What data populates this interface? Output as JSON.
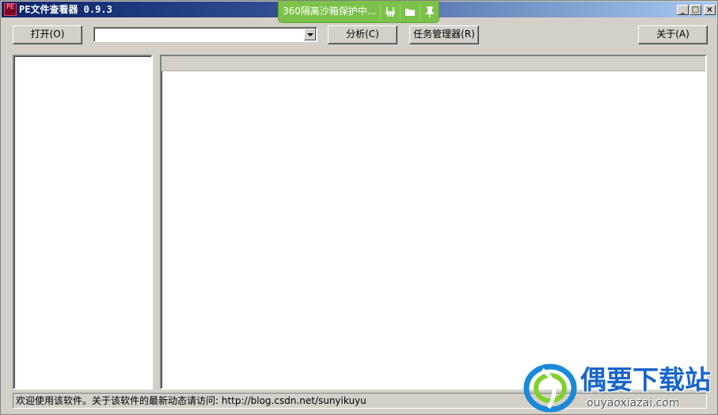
{
  "window": {
    "title": "PE文件查看器 0.9.3",
    "app_icon_text": "PE"
  },
  "caption_buttons": {
    "minimize": "_",
    "maximize": "□",
    "close": "×"
  },
  "sandbox": {
    "text": "360隔离沙箱保护中...",
    "color": "#7cc24a",
    "icons": [
      "sweep-icon",
      "folder-icon",
      "pin-icon"
    ]
  },
  "toolbar": {
    "open_label": "打开(O)",
    "file_combo_value": "",
    "analyze_label": "分析(C)",
    "taskmgr_label": "任务管理器(R)",
    "about_label": "关于(A)"
  },
  "statusbar": {
    "text": "欢迎使用该软件。关于该软件的最新动态请访问: http://blog.csdn.net/sunyikuyu"
  },
  "watermark": {
    "title": "偶要下载站",
    "url": "ouyaoxiazai.com",
    "color": "#1a66c8"
  }
}
